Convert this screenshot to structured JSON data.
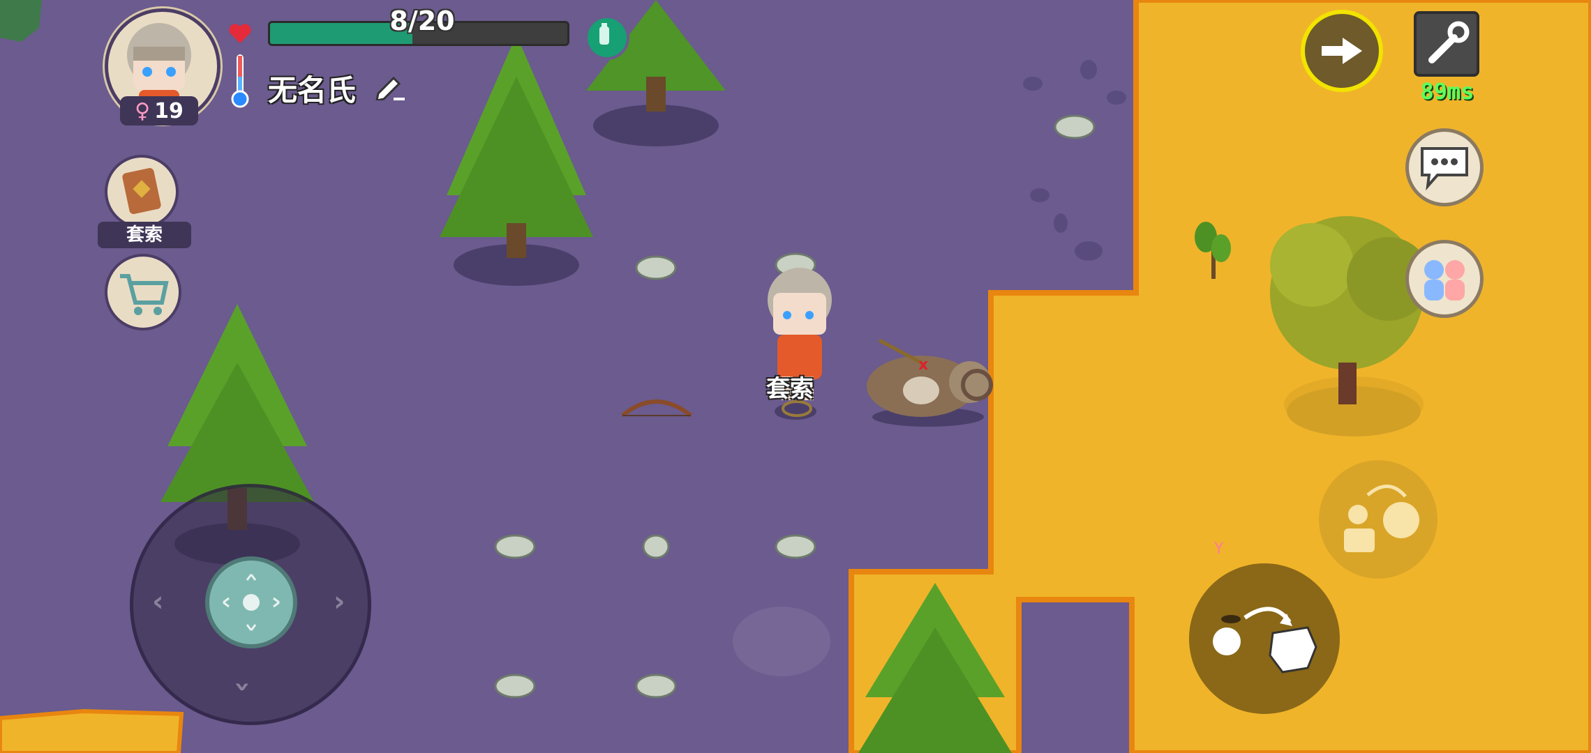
{
  "hud": {
    "health_text": "8/20",
    "health_fraction": 0.48,
    "player_name": "无名氏",
    "age": "19",
    "gender_symbol": "♀",
    "tool_label": "套索",
    "ping": "89ms"
  },
  "world": {
    "dropped_item_label": "套索"
  },
  "icons": {
    "heart": "heart-icon",
    "thermometer": "thermometer-icon",
    "bottle": "water-bottle-icon",
    "pencil": "edit-pencil-icon",
    "exit": "arrow-right-icon",
    "settings": "wrench-icon",
    "chat": "chat-bubble-icon",
    "family": "family-icon",
    "shop": "shopping-cart-icon"
  },
  "colors": {
    "ground": "#6b5b8e",
    "desert": "#f0b42a",
    "health": "#1f9b73",
    "exit_ring": "#f2e300",
    "ping": "#5cff5c"
  }
}
